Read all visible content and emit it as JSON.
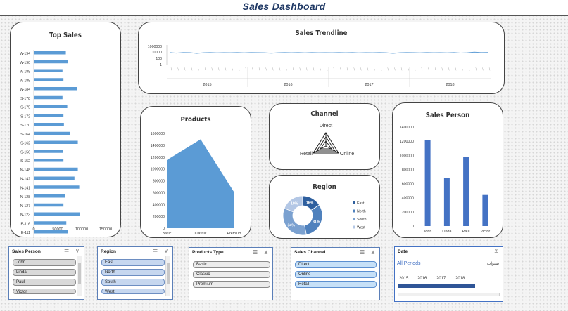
{
  "dashboard": {
    "title": "Sales Dashboard"
  },
  "top_sales": {
    "title": "Top Sales",
    "chart_data": {
      "type": "bar",
      "orientation": "horizontal",
      "categories": [
        "W-194",
        "W-190",
        "W-188",
        "W-185",
        "W-184",
        "S-178",
        "S-175",
        "S-172",
        "S-170",
        "S-164",
        "S-162",
        "S-156",
        "S-152",
        "N-148",
        "N-142",
        "N-141",
        "N-128",
        "N-127",
        "N-123",
        "E-116",
        "E-111"
      ],
      "values": [
        67000,
        72000,
        60000,
        62000,
        90000,
        60000,
        70000,
        62000,
        63000,
        75000,
        92000,
        61000,
        62000,
        92000,
        85000,
        95000,
        65000,
        62000,
        96000,
        68000,
        72000
      ],
      "xlim": [
        0,
        150000
      ],
      "xticks": [
        "0",
        "50000",
        "100000",
        "150000"
      ]
    }
  },
  "trendline": {
    "title": "Sales Trendline",
    "chart_data": {
      "type": "line",
      "yscale": "log",
      "yticks": [
        "1000000",
        "10000",
        "100",
        "1"
      ],
      "years": [
        "2015",
        "2016",
        "2017",
        "2018"
      ],
      "values": [
        9000,
        6000,
        9000,
        8500,
        5000,
        8000,
        9000,
        7000,
        8500,
        8000,
        9000,
        7000,
        9000,
        8500,
        8000,
        5500,
        8000,
        9000,
        8000,
        9000,
        7500,
        9000,
        8000,
        8500,
        8000,
        9000,
        8000,
        9000,
        7000,
        8500,
        8000,
        9000,
        8000,
        5000,
        8000,
        9000,
        8500,
        7000,
        9000,
        8000,
        8500,
        7000,
        9000,
        6500,
        8000,
        12000,
        9000,
        10000
      ],
      "color": "#5b9bd5"
    }
  },
  "products": {
    "title": "Products",
    "chart_data": {
      "type": "area",
      "categories": [
        "Basic",
        "Classic",
        "Premium"
      ],
      "values": [
        1150000,
        1500000,
        600000
      ],
      "ylim": [
        0,
        1600000
      ],
      "yticks": [
        "1600000",
        "1400000",
        "1200000",
        "1000000",
        "800000",
        "600000",
        "400000",
        "200000",
        "0"
      ],
      "color": "#5b9bd5"
    }
  },
  "channel": {
    "title": "Channel",
    "labels": {
      "top": "Direct",
      "left": "Retail",
      "right": "Online"
    }
  },
  "region": {
    "title": "Region",
    "chart_data": {
      "type": "pie",
      "donut": true,
      "categories": [
        "East",
        "North",
        "South",
        "West"
      ],
      "values": [
        16,
        31,
        34,
        19
      ],
      "labels": [
        "16%",
        "31%",
        "34%",
        "19%"
      ],
      "colors": [
        "#2e5f9e",
        "#4f81bd",
        "#7ba1d0",
        "#b3c7e5"
      ]
    }
  },
  "sales_person_chart": {
    "title": "Sales Person",
    "chart_data": {
      "type": "bar",
      "categories": [
        "John",
        "Linda",
        "Paul",
        "Victor"
      ],
      "values": [
        1220000,
        680000,
        980000,
        440000
      ],
      "ylim": [
        0,
        1400000
      ],
      "yticks": [
        "1400000",
        "1200000",
        "1000000",
        "800000",
        "600000",
        "400000",
        "200000",
        "0"
      ],
      "color": "#4472c4"
    }
  },
  "slicers": {
    "sales_person": {
      "header": "Sales Person",
      "items": [
        "John",
        "Linda",
        "Paul",
        "Victor"
      ]
    },
    "region": {
      "header": "Region",
      "items": [
        "East",
        "North",
        "South",
        "West"
      ]
    },
    "products_type": {
      "header": "Products Type",
      "items": [
        "Basic",
        "Classic",
        "Premium"
      ]
    },
    "sales_channel": {
      "header": "Sales Channel",
      "items": [
        "Direct",
        "Online",
        "Retail"
      ]
    },
    "date": {
      "header": "Date",
      "periods": "All Periods",
      "level": "سنوات",
      "years": [
        "2015",
        "2016",
        "2017",
        "2018"
      ]
    }
  }
}
